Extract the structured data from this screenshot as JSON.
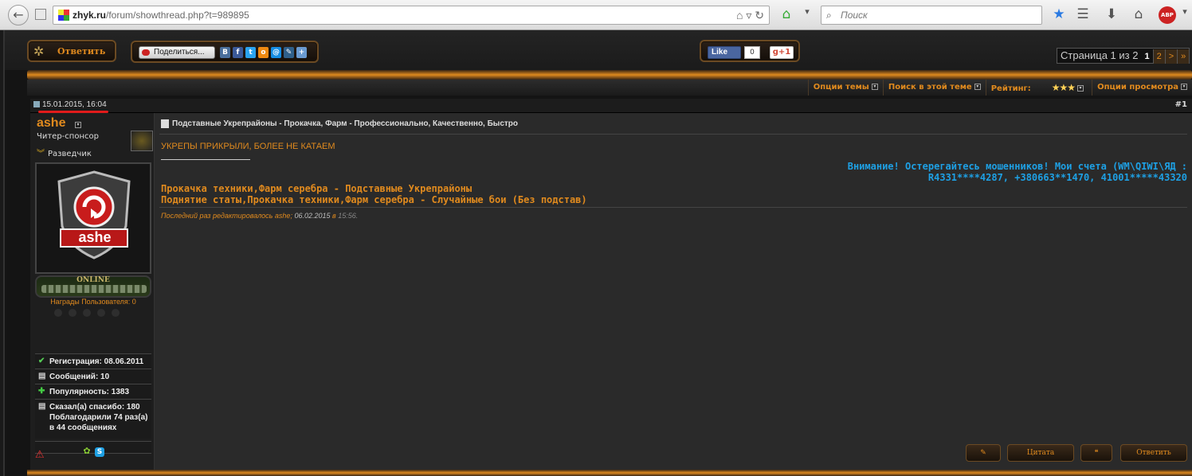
{
  "browser": {
    "url_domain": "zhyk.ru",
    "url_path": "/forum/showthread.php?t=989895",
    "search_placeholder": "Поиск",
    "abp_badge": "ABP"
  },
  "toolbar": {
    "reply_label": "Ответить",
    "share_label": "Поделиться...",
    "share_icons": [
      {
        "name": "vk-icon",
        "glyph": "B",
        "color": "#4a6f9c"
      },
      {
        "name": "facebook-icon",
        "glyph": "f",
        "color": "#3b5998"
      },
      {
        "name": "twitter-icon",
        "glyph": "t",
        "color": "#2aa3ef"
      },
      {
        "name": "odnoklassniki-icon",
        "glyph": "o",
        "color": "#f08a12"
      },
      {
        "name": "mailru-icon",
        "glyph": "@",
        "color": "#168de2"
      },
      {
        "name": "livejournal-icon",
        "glyph": "✎",
        "color": "#2f5f8a"
      },
      {
        "name": "bookmark-icon",
        "glyph": "+",
        "color": "#6a9ad0"
      }
    ],
    "fb_like": "Like",
    "fb_count": "0",
    "gplus": "g+1",
    "pagination": {
      "label": "Страница 1 из 2",
      "current": "1",
      "next_page": "2",
      "next": ">",
      "last": "»"
    }
  },
  "tools": {
    "thread_options": "Опции темы",
    "search_thread": "Поиск в этой теме",
    "rating_label": "Рейтинг:",
    "rating_stars": "★★★",
    "view_options": "Опции просмотра"
  },
  "post": {
    "date": "15.01.2015,",
    "time": "16:04",
    "number": "#1",
    "title": "Подставные Укрепрайоны - Прокачка, Фарм - Профессионально, Качественно, Быстро",
    "closed_notice": "УКРЕПЫ ПРИКРЫЛИ, БОЛЕЕ НЕ КАТАЕМ",
    "warning_line1": "Внимание! Остерегайтесь мошенников! Мои счета (WM\\QIWI\\ЯД :",
    "warning_line2": "R4331****4287, +380663**1470, 41001*****43320",
    "service_line1": "Прокачка техники,Фарм серебра - Подставные Укрепрайоны",
    "service_line2": "Поднятие статы,Прокачка техники,Фарм серебра - Случайные бои (Без подстав)",
    "edited_prefix": "Последний раз редактировалось ashe",
    "edited_date": "06.02.2015",
    "edited_in": "в",
    "edited_time": "15:56.",
    "buttons": {
      "quote": "Цитата",
      "reply": "Ответить"
    }
  },
  "user": {
    "name": "ashe",
    "title": "Читер-спонсор",
    "rank": "Разведчик",
    "avatar_text": "ashe",
    "online": "ONLINE",
    "awards": "Награды Пользователя: 0",
    "registration": "Регистрация: 08.06.2011",
    "messages": "Сообщений: 10",
    "popularity": "Популярность: 1383",
    "thanks_line1": "Сказал(а) спасибо: 180",
    "thanks_line2": "Поблагодарили 74 раз(а)",
    "thanks_line3": "в 44 сообщениях"
  }
}
